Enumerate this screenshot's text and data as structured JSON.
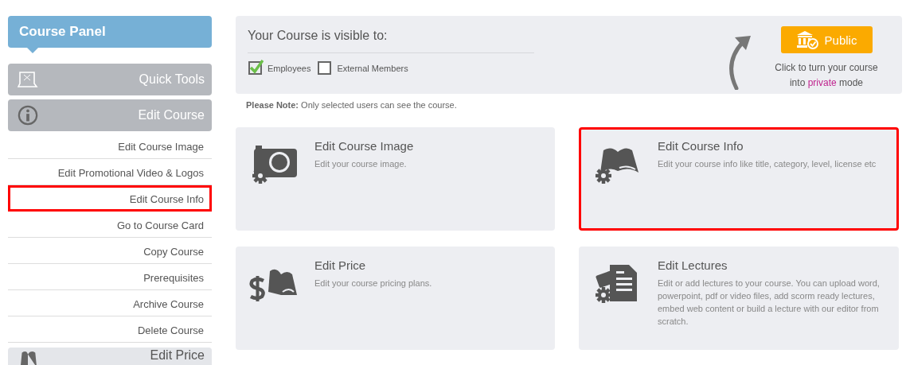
{
  "sidebar": {
    "title": "Course Panel",
    "sections": [
      {
        "label": "Quick Tools",
        "kind": "tools"
      },
      {
        "label": "Edit Course",
        "kind": "info",
        "items": [
          {
            "label": "Edit Course Image",
            "highlighted": false
          },
          {
            "label": "Edit Promotional Video & Logos",
            "highlighted": false
          },
          {
            "label": "Edit Course Info",
            "highlighted": true
          },
          {
            "label": "Go to Course Card",
            "highlighted": false
          },
          {
            "label": "Copy Course",
            "highlighted": false
          },
          {
            "label": "Prerequisites",
            "highlighted": false
          },
          {
            "label": "Archive Course",
            "highlighted": false
          },
          {
            "label": "Delete Course",
            "highlighted": false
          }
        ]
      },
      {
        "label": "Edit Price",
        "kind": "price"
      }
    ]
  },
  "visibility": {
    "title": "Your Course is visible to:",
    "options": [
      {
        "label": "Employees",
        "checked": true
      },
      {
        "label": "External Members",
        "checked": false
      }
    ],
    "note": "**Please Note:** Only selected users can see the course.",
    "button": "Public",
    "hint_before": "Click to turn your course into ",
    "hint_link": "private",
    "hint_after": " mode"
  },
  "cards": [
    {
      "kind": "image",
      "title": "Edit Course Image",
      "description": "Edit your course image.",
      "highlighted": false
    },
    {
      "kind": "info",
      "title": "Edit Course Info",
      "description": "Edit your course info like title, category, level, license etc",
      "highlighted": true
    },
    {
      "kind": "price",
      "title": "Edit Price",
      "description": "Edit your course pricing plans.",
      "highlighted": false
    },
    {
      "kind": "lectures",
      "title": "Edit Lectures",
      "description": "Edit or add lectures to your course. You can upload word, powerpoint, pdf or video files, add scorm ready lectures, embed web content or build a lecture with our editor from scratch.",
      "highlighted": false
    }
  ]
}
